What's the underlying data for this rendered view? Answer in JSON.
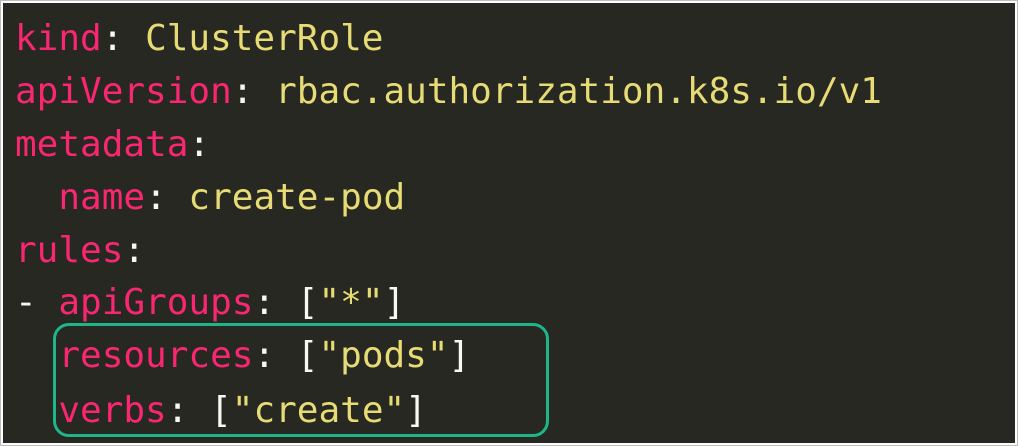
{
  "code": {
    "kind_key": "kind",
    "kind_value": "ClusterRole",
    "api_version_key": "apiVersion",
    "api_version_value": "rbac.authorization.k8s.io/v1",
    "metadata_key": "metadata",
    "name_key": "name",
    "name_value": "create-pod",
    "rules_key": "rules",
    "api_groups_key": "apiGroups",
    "api_groups_value": "\"*\"",
    "resources_key": "resources",
    "resources_value": "\"pods\"",
    "verbs_key": "verbs",
    "verbs_value": "\"create\""
  },
  "colors": {
    "background": "#272822",
    "key": "#f92672",
    "value": "#e6db74",
    "punctuation": "#f8f8f2",
    "highlight": "#1fb58a"
  }
}
